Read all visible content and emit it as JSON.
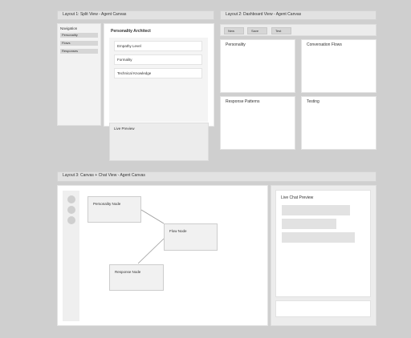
{
  "layout1": {
    "header": "Layout 1: Split View - Agent Canvas",
    "nav": {
      "title": "Navigation",
      "items": [
        "Personality",
        "Flows",
        "Responses"
      ]
    },
    "main": {
      "title": "Personality Architect",
      "fields": [
        "Empathy Level",
        "Formality",
        "Technical Knowledge"
      ]
    },
    "preview_label": "Live Preview"
  },
  "layout2": {
    "header": "Layout 2: Dashboard View - Agent Canvas",
    "toolbar": [
      "New",
      "Save",
      "Test"
    ],
    "panels": [
      "Personality",
      "Conversation Flows",
      "Response Patterns",
      "Testing"
    ]
  },
  "layout3": {
    "header": "Layout 3: Canvas + Chat View - Agent Canvas",
    "nodes": [
      "Personality Node",
      "Flow Node",
      "Response Node"
    ],
    "chat_title": "Live Chat Preview"
  },
  "colors": {
    "background": "#cfcfcf",
    "header": "#e2e2e2",
    "panel": "#ffffff",
    "muted": "#d6d6d6"
  }
}
